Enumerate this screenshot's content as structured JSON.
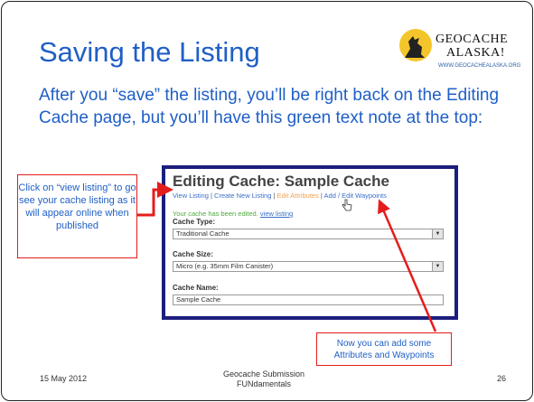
{
  "slide": {
    "title": "Saving the Listing",
    "body": "After you “save” the listing, you’ll be right back on the Editing Cache page, but you’ll have this green text note at the top:",
    "logo": {
      "line1": "GEOCACHE",
      "line2": "ALASKA!",
      "url": "WWW.GEOCACHEALASKA.ORG"
    },
    "callout_left": "Click on “view listing” to go see your cache listing as it will appear online when published",
    "callout_right": "Now you can add some Attributes and Waypoints",
    "footer": {
      "date": "15 May 2012",
      "title": "Geocache Submission FUNdamentals",
      "page": "26"
    },
    "colors": {
      "title": "#1f5fc6",
      "callout_border": "#e51c1c",
      "arrow": "#e51c1c",
      "screenshot_border": "#1c1e7e",
      "note_green": "#4caa3c"
    }
  },
  "screenshot": {
    "heading": "Editing Cache: Sample Cache",
    "links": {
      "view_listing": "View Listing",
      "create_new_listing": "Create New Listing",
      "edit_attributes": "Edit Attributes",
      "add_edit_waypoints": "Add / Edit Waypoints",
      "separator": "|"
    },
    "note": {
      "text": "Your cache has been edited.",
      "link": "view listing"
    },
    "fields": {
      "cache_type": {
        "label": "Cache Type:",
        "value": "Traditional Cache"
      },
      "cache_size": {
        "label": "Cache Size:",
        "value": "Micro (e.g. 35mm Film Canister)"
      },
      "cache_name": {
        "label": "Cache Name:",
        "value": "Sample Cache"
      }
    },
    "icons": {
      "dropdown": "chevron-down-icon",
      "cursor": "hand-cursor-icon"
    }
  }
}
